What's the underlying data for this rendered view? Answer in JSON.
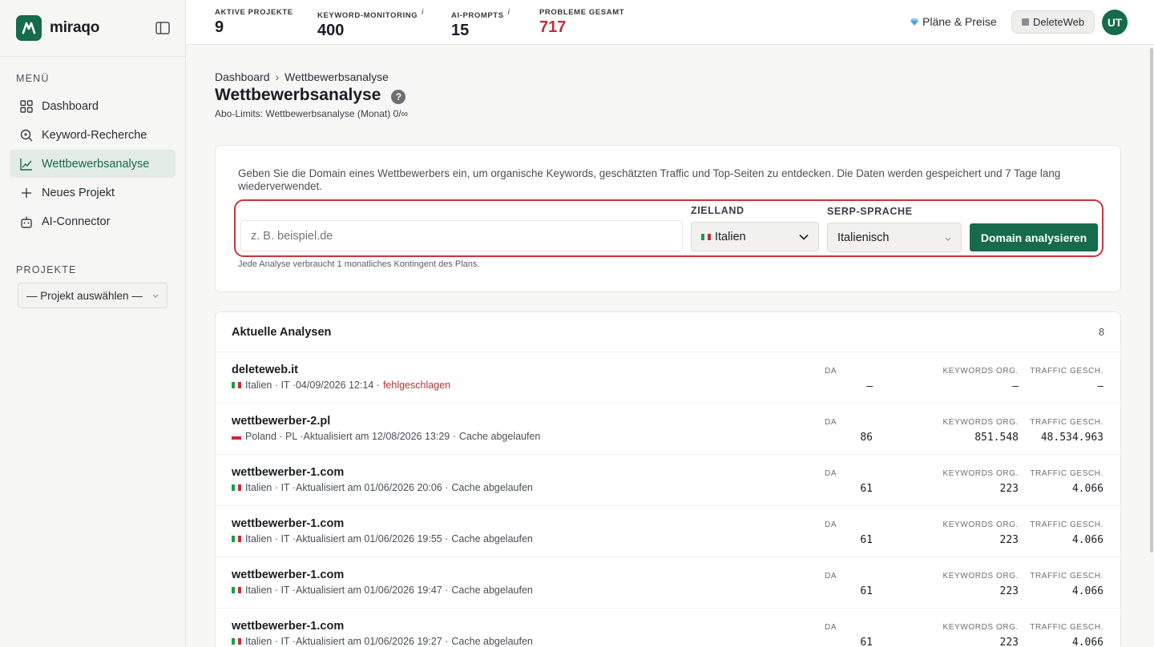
{
  "app": {
    "name": "miraqo",
    "logo_letter": "M",
    "accent_color": "#156b4a",
    "danger_color": "#b8323a"
  },
  "sidebar": {
    "menu_label": "MENÜ",
    "items": [
      {
        "label": "Dashboard",
        "icon": "grid-icon",
        "active": false
      },
      {
        "label": "Keyword-Recherche",
        "icon": "search-icon",
        "active": false
      },
      {
        "label": "Wettbewerbsanalyse",
        "icon": "chart-line-icon",
        "active": true
      },
      {
        "label": "Neues Projekt",
        "icon": "plus-icon",
        "active": false
      },
      {
        "label": "AI-Connector",
        "icon": "robot-icon",
        "active": false
      }
    ],
    "projects_label": "PROJEKTE",
    "project_select": "— Projekt auswählen —"
  },
  "topbar": {
    "stats": [
      {
        "label": "AKTIVE PROJEKTE",
        "value": "9",
        "info": false
      },
      {
        "label": "KEYWORD-MONITORING",
        "value": "400",
        "info": true
      },
      {
        "label": "AI-PROMPTS",
        "value": "15",
        "info": true
      },
      {
        "label": "PROBLEME GESAMT",
        "value": "717",
        "info": false
      }
    ],
    "info_mark": "i",
    "plans_link": "Pläne & Preise",
    "workspace": "DeleteWeb",
    "avatar": "UT"
  },
  "page": {
    "breadcrumb_root": "Dashboard",
    "breadcrumb_sep": "›",
    "breadcrumb_current": "Wettbewerbsanalyse",
    "title": "Wettbewerbsanalyse",
    "help": "?",
    "limits": "Abo-Limits: Wettbewerbsanalyse (Monat) 0/∞"
  },
  "form": {
    "intro": "Geben Sie die Domain eines Wettbewerbers ein, um organische Keywords, geschätzten Traffic und Top-Seiten zu entdecken. Die Daten werden gespeichert und 7 Tage lang wiederverwendet.",
    "domain_placeholder": "z. B. beispiel.de",
    "domain_value": "",
    "country_label": "ZIELLAND",
    "country_value": "Italien",
    "language_label": "SERP-SPRACHE",
    "language_value": "Italienisch",
    "submit": "Domain analysieren",
    "hint": "Jede Analyse verbraucht 1 monatliches Kontingent des Plans."
  },
  "analyses": {
    "title": "Aktuelle Analysen",
    "count": "8",
    "col_da": "DA",
    "col_keywords": "KEYWORDS ORG.",
    "col_traffic": "TRAFFIC GESCH.",
    "rows": [
      {
        "domain": "deleteweb.it",
        "flag": "it",
        "country": "Italien · IT · ",
        "date": "04/09/2026 12:14 · ",
        "status": "fehlgeschlagen",
        "failed": true,
        "da": "—",
        "keywords": "—",
        "traffic": "—"
      },
      {
        "domain": "wettbewerber-2.pl",
        "flag": "pl",
        "country": "Poland · PL · ",
        "date": "Aktualisiert am 12/08/2026 13:29 · ",
        "status": "Cache abgelaufen",
        "failed": false,
        "da": "86",
        "keywords": "851.548",
        "traffic": "48.534.963"
      },
      {
        "domain": "wettbewerber-1.com",
        "flag": "it",
        "country": "Italien · IT · ",
        "date": "Aktualisiert am 01/06/2026 20:06 · ",
        "status": "Cache abgelaufen",
        "failed": false,
        "da": "61",
        "keywords": "223",
        "traffic": "4.066"
      },
      {
        "domain": "wettbewerber-1.com",
        "flag": "it",
        "country": "Italien · IT · ",
        "date": "Aktualisiert am 01/06/2026 19:55 · ",
        "status": "Cache abgelaufen",
        "failed": false,
        "da": "61",
        "keywords": "223",
        "traffic": "4.066"
      },
      {
        "domain": "wettbewerber-1.com",
        "flag": "it",
        "country": "Italien · IT · ",
        "date": "Aktualisiert am 01/06/2026 19:47 · ",
        "status": "Cache abgelaufen",
        "failed": false,
        "da": "61",
        "keywords": "223",
        "traffic": "4.066"
      },
      {
        "domain": "wettbewerber-1.com",
        "flag": "it",
        "country": "Italien · IT · ",
        "date": "Aktualisiert am 01/06/2026 19:27 · ",
        "status": "Cache abgelaufen",
        "failed": false,
        "da": "61",
        "keywords": "223",
        "traffic": "4.066"
      }
    ]
  }
}
